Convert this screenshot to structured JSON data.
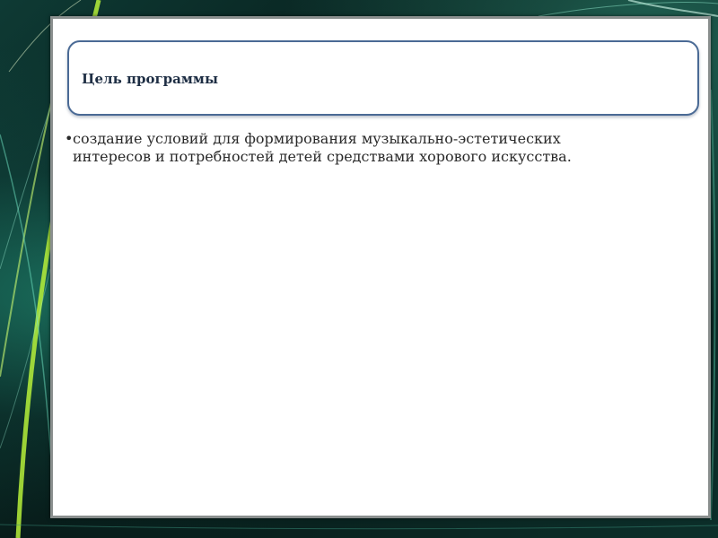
{
  "title": "Цель программы",
  "bullet_char": "•",
  "body_lines": [
    "создание условий для формирования музыкально-эстетических",
    "интересов и потребностей детей средствами хорового искусства."
  ],
  "colors": {
    "title_border": "#4a6a95",
    "title_text": "#1e2e44",
    "background_accent": "#a8e23a"
  }
}
